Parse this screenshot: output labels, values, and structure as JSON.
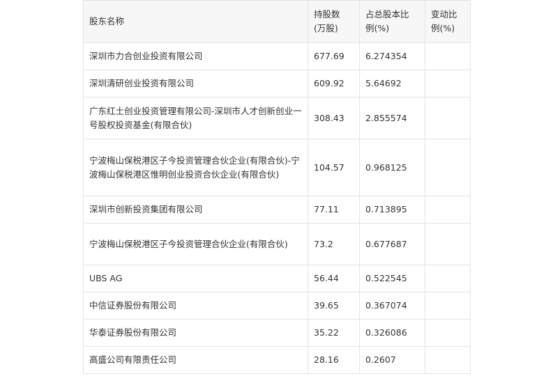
{
  "table": {
    "headers": {
      "name": "股东名称",
      "shares_line1": "持股数",
      "shares_line2": "(万股)",
      "ratio_line1": "占总股本比",
      "ratio_line2": "例(%)",
      "change_line1": "变动比",
      "change_line2": "例(%)"
    },
    "rows": [
      {
        "name": "深圳市力合创业投资有限公司",
        "shares": "677.69",
        "ratio": "6.274354",
        "change": ""
      },
      {
        "name": "深圳清研创业投资有限公司",
        "shares": "609.92",
        "ratio": "5.64692",
        "change": ""
      },
      {
        "name": "广东红土创业投资管理有限公司-深圳市人才创新创业一号股权投资基金(有限合伙)",
        "shares": "308.43",
        "ratio": "2.855574",
        "change": ""
      },
      {
        "name": "宁波梅山保税港区子今投资管理合伙企业(有限合伙)-宁波梅山保税港区惟明创业投资合伙企业(有限合伙)",
        "shares": "104.57",
        "ratio": "0.968125",
        "change": ""
      },
      {
        "name": "深圳市创新投资集团有限公司",
        "shares": "77.11",
        "ratio": "0.713895",
        "change": ""
      },
      {
        "name": "宁波梅山保税港区子今投资管理合伙企业(有限合伙)",
        "shares": "73.2",
        "ratio": "0.677687",
        "change": ""
      },
      {
        "name": "UBS AG",
        "shares": "56.44",
        "ratio": "0.522545",
        "change": ""
      },
      {
        "name": "中信证券股份有限公司",
        "shares": "39.65",
        "ratio": "0.367074",
        "change": ""
      },
      {
        "name": "华泰证券股份有限公司",
        "shares": "35.22",
        "ratio": "0.326086",
        "change": ""
      },
      {
        "name": "高盛公司有限责任公司",
        "shares": "28.16",
        "ratio": "0.2607",
        "change": ""
      }
    ]
  }
}
